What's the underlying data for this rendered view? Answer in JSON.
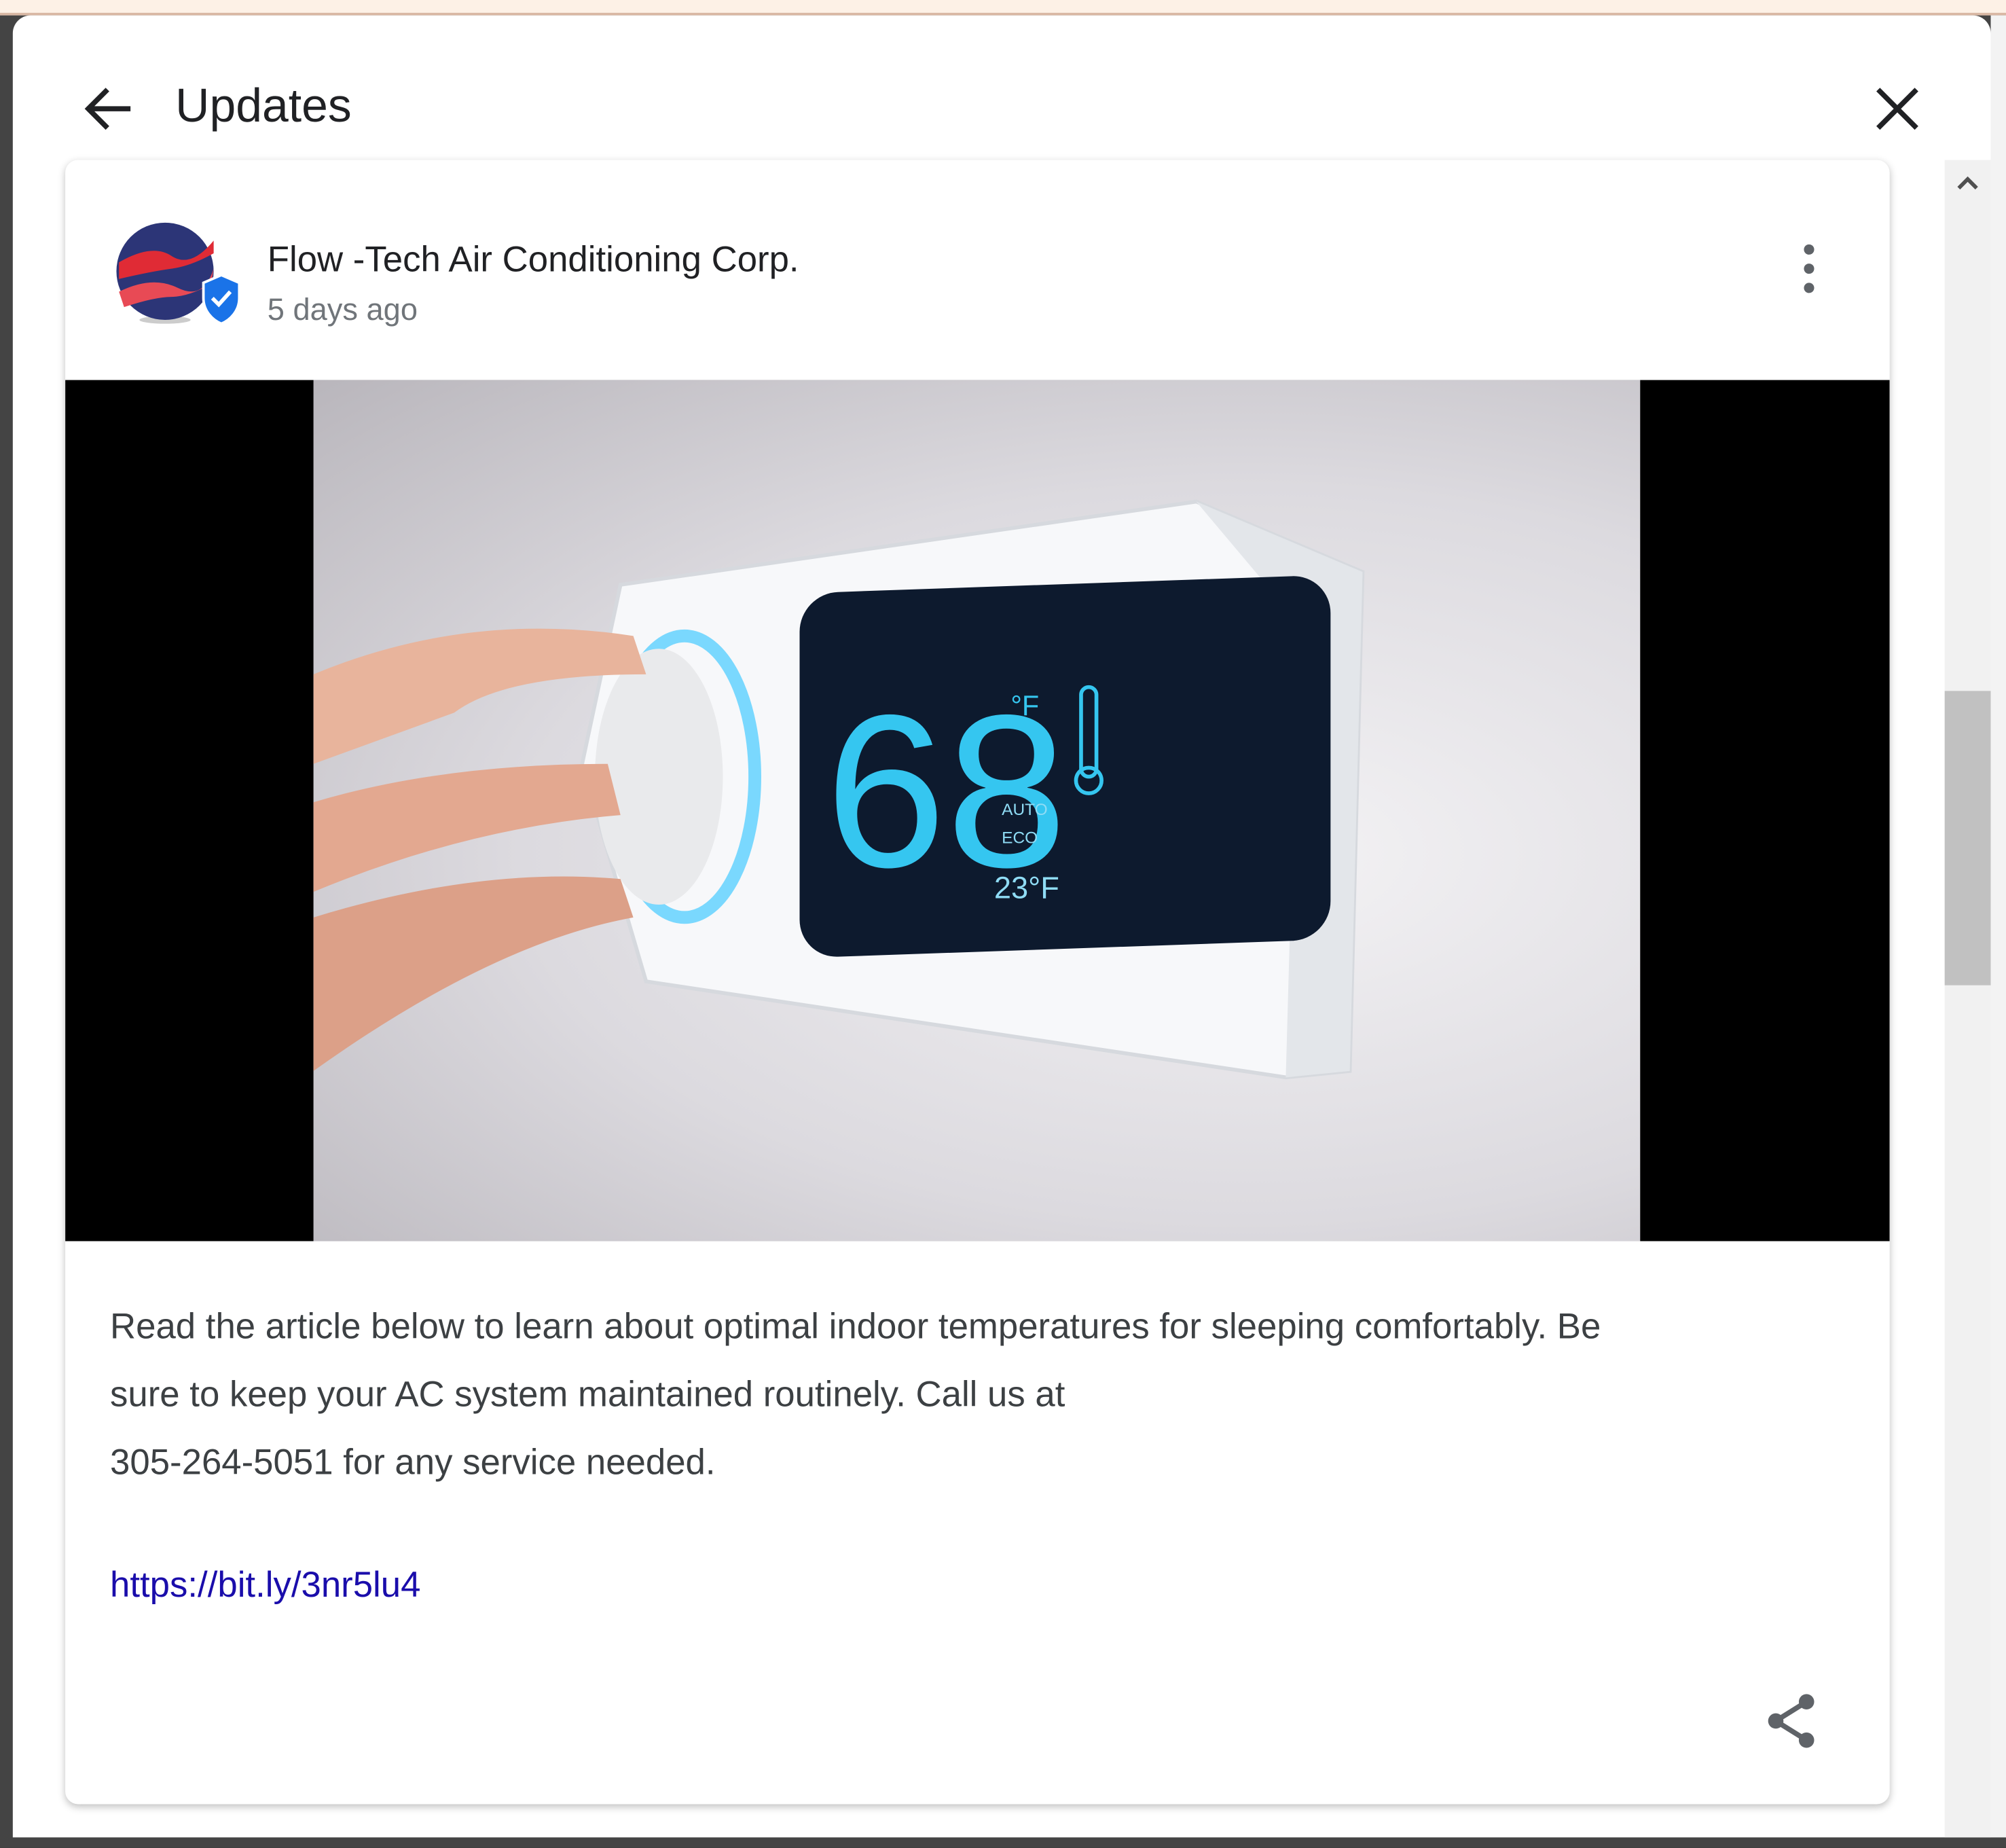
{
  "header": {
    "title": "Updates",
    "back_icon": "arrow-left-icon",
    "close_icon": "close-icon"
  },
  "post": {
    "business_name": "Flow -Tech Air Conditioning Corp.",
    "time_ago": "5 days ago",
    "verified": true,
    "body_lines": [
      "Read the article below to learn about optimal indoor temperatures for sleeping comfortably.  Be",
      "sure to keep your AC system maintained routinely.  Call us at",
      "305-264-5051 for any service needed."
    ],
    "link": "https://bit.ly/3nr5lu4",
    "image_text": {
      "temp": "68",
      "unit": "°F",
      "mode1": "AUTO",
      "mode2": "ECO",
      "outside": "23°F"
    }
  },
  "colors": {
    "link": "#1a0dab",
    "verified": "#1a73e8",
    "screen_text": "#35c6f0"
  }
}
